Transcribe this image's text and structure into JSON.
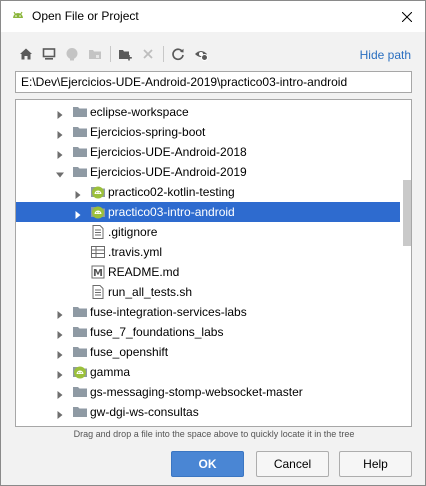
{
  "window": {
    "title": "Open File or Project"
  },
  "toolbar": {
    "buttons": [
      {
        "icon": "home-icon"
      },
      {
        "icon": "desktop-icon"
      },
      {
        "icon": "project-icon"
      },
      {
        "icon": "module-folder-icon"
      },
      {
        "icon": "new-folder-icon"
      },
      {
        "icon": "delete-icon"
      },
      {
        "icon": "refresh-icon"
      },
      {
        "icon": "show-hidden-icon"
      }
    ],
    "hide_path_label": "Hide path"
  },
  "path_field": {
    "value": "E:\\Dev\\Ejercicios-UDE-Android-2019\\practico03-intro-android"
  },
  "tree": {
    "items": [
      {
        "label": "eclipse-workspace",
        "type": "folder",
        "expanded": false,
        "depth": 0
      },
      {
        "label": "Ejercicios-spring-boot",
        "type": "folder",
        "expanded": false,
        "depth": 0
      },
      {
        "label": "Ejercicios-UDE-Android-2018",
        "type": "folder",
        "expanded": false,
        "depth": 0
      },
      {
        "label": "Ejercicios-UDE-Android-2019",
        "type": "folder",
        "expanded": true,
        "depth": 0
      },
      {
        "label": "practico02-kotlin-testing",
        "type": "android-project",
        "expanded": false,
        "depth": 1
      },
      {
        "label": "practico03-intro-android",
        "type": "android-project",
        "expanded": false,
        "depth": 1,
        "selected": true
      },
      {
        "label": ".gitignore",
        "type": "file",
        "depth": 1
      },
      {
        "label": ".travis.yml",
        "type": "yml-file",
        "depth": 1
      },
      {
        "label": "README.md",
        "type": "md-file",
        "depth": 1
      },
      {
        "label": "run_all_tests.sh",
        "type": "file",
        "depth": 1
      },
      {
        "label": "fuse-integration-services-labs",
        "type": "folder",
        "expanded": false,
        "depth": 0
      },
      {
        "label": "fuse_7_foundations_labs",
        "type": "folder",
        "expanded": false,
        "depth": 0
      },
      {
        "label": "fuse_openshift",
        "type": "folder",
        "expanded": false,
        "depth": 0
      },
      {
        "label": "gamma",
        "type": "android-project",
        "expanded": false,
        "depth": 0
      },
      {
        "label": "gs-messaging-stomp-websocket-master",
        "type": "folder",
        "expanded": false,
        "depth": 0
      },
      {
        "label": "gw-dgi-ws-consultas",
        "type": "folder",
        "expanded": false,
        "depth": 0
      }
    ]
  },
  "hint": "Drag and drop a file into the space above to quickly locate it in the tree",
  "buttons": {
    "ok": "OK",
    "cancel": "Cancel",
    "help": "Help"
  },
  "colors": {
    "selection": "#2e6bcf",
    "accent": "#4a86d4",
    "link": "#2a6fc0",
    "android_green": "#9bc03b"
  }
}
